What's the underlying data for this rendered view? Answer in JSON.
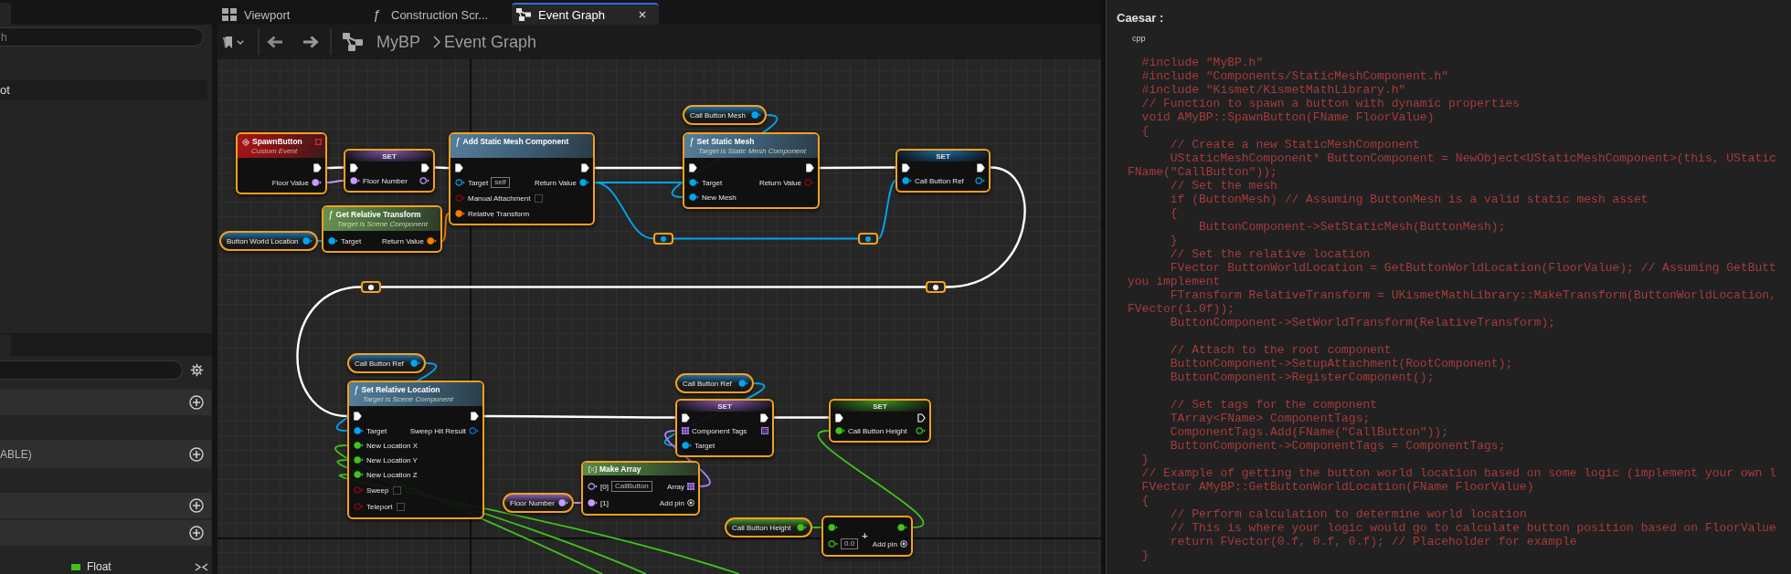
{
  "left_panel": {
    "components": {
      "search": {
        "placeholder": "h"
      },
      "items": [
        {
          "label": "ot"
        }
      ]
    },
    "my_blueprint": {
      "sections": [
        {
          "add_button": true
        },
        {
          "label": "ABLE)",
          "add_button": true
        },
        {
          "add_button": true
        },
        {
          "add_button": true
        }
      ],
      "variables": [
        {
          "type_label": "Float",
          "color": "#3cc21a"
        }
      ]
    }
  },
  "tabs": [
    {
      "label": "Viewport",
      "kind": "viewport",
      "selected": false
    },
    {
      "label": "Construction Scr...",
      "kind": "function",
      "glyph": "ƒ",
      "selected": false
    },
    {
      "label": "Event Graph",
      "kind": "graph",
      "selected": true,
      "closable": true
    }
  ],
  "breadcrumb": [
    "MyBP",
    "Event Graph"
  ],
  "graph": {
    "nodes": [
      {
        "kind": "getter",
        "title": "Call Button Mesh",
        "selected": true,
        "outputs": [
          {
            "kind": "object",
            "connected": true
          }
        ]
      },
      {
        "kind": "event",
        "title": "SpawnButton",
        "subtitle": "Custom Event",
        "selected": true,
        "header_pin": {
          "kind": "delegate",
          "connected": false
        },
        "outputs": [
          {
            "kind": "exec",
            "connected": true
          },
          {
            "label": "Floor Value",
            "kind": "name",
            "connected": true
          }
        ]
      },
      {
        "kind": "setter",
        "title": "SET",
        "selected": true,
        "inputs": [
          {
            "kind": "exec",
            "connected": true
          },
          {
            "label": "Floor Number",
            "kind": "name",
            "connected": true
          }
        ],
        "outputs": [
          {
            "kind": "exec",
            "connected": true
          },
          {
            "kind": "name",
            "connected": false
          }
        ]
      },
      {
        "kind": "function",
        "glyph": "ƒ",
        "title": "Add Static Mesh Component",
        "selected": true,
        "inputs": [
          {
            "kind": "exec",
            "connected": true
          },
          {
            "label": "Target",
            "kind": "object",
            "connected": false,
            "value": "self"
          },
          {
            "label": "Manual Attachment",
            "kind": "bool",
            "connected": false,
            "checked": false
          },
          {
            "label": "Relative Transform",
            "kind": "transform",
            "connected": true
          }
        ],
        "outputs": [
          {
            "kind": "exec",
            "connected": true
          },
          {
            "label": "Return Value",
            "kind": "object",
            "connected": true
          }
        ]
      },
      {
        "kind": "function",
        "glyph": "ƒ",
        "title": "Set Static Mesh",
        "subtitle": "Target is Static Mesh Component",
        "selected": true,
        "inputs": [
          {
            "kind": "exec",
            "connected": true
          },
          {
            "label": "Target",
            "kind": "object",
            "connected": true
          },
          {
            "label": "New Mesh",
            "kind": "object",
            "connected": true
          }
        ],
        "outputs": [
          {
            "kind": "exec",
            "connected": true
          },
          {
            "label": "Return Value",
            "kind": "bool",
            "connected": false
          }
        ]
      },
      {
        "kind": "setter",
        "title": "SET",
        "selected": true,
        "inputs": [
          {
            "kind": "exec",
            "connected": true
          },
          {
            "label": "Call Button Ref",
            "kind": "object",
            "connected": true
          }
        ],
        "outputs": [
          {
            "kind": "exec",
            "connected": true
          },
          {
            "kind": "object",
            "connected": false
          }
        ]
      },
      {
        "kind": "getter",
        "title": "Button World Location",
        "selected": true,
        "outputs": [
          {
            "kind": "object",
            "connected": true
          }
        ]
      },
      {
        "kind": "pure",
        "glyph": "ƒ",
        "title": "Get Relative Transform",
        "subtitle": "Target is Scene Component",
        "selected": true,
        "inputs": [
          {
            "label": "Target",
            "kind": "object",
            "connected": true
          }
        ],
        "outputs": [
          {
            "label": "Return Value",
            "kind": "transform",
            "connected": true
          }
        ]
      },
      {
        "kind": "reroute",
        "selected": true,
        "outputs": [
          {
            "kind": "object",
            "connected": true
          }
        ]
      },
      {
        "kind": "reroute",
        "selected": true,
        "outputs": [
          {
            "kind": "object",
            "connected": true
          }
        ]
      },
      {
        "kind": "reroute",
        "selected": true,
        "outputs": [
          {
            "kind": "exec",
            "connected": true
          }
        ]
      },
      {
        "kind": "reroute",
        "selected": true,
        "outputs": [
          {
            "kind": "exec",
            "connected": true
          }
        ]
      },
      {
        "kind": "getter",
        "title": "Call Button Ref",
        "selected": true,
        "outputs": [
          {
            "kind": "object",
            "connected": true
          }
        ]
      },
      {
        "kind": "function",
        "glyph": "ƒ",
        "title": "Set Relative Location",
        "subtitle": "Target is Scene Component",
        "selected": true,
        "inputs": [
          {
            "kind": "exec",
            "connected": true
          },
          {
            "label": "Target",
            "kind": "object",
            "connected": true
          },
          {
            "label": "New Location X",
            "kind": "float",
            "connected": true
          },
          {
            "label": "New Location Y",
            "kind": "float",
            "connected": true
          },
          {
            "label": "New Location Z",
            "kind": "float",
            "connected": true
          },
          {
            "label": "Sweep",
            "kind": "bool",
            "connected": false,
            "checked": false
          },
          {
            "label": "Teleport",
            "kind": "bool",
            "connected": false,
            "checked": false
          }
        ],
        "outputs": [
          {
            "kind": "exec",
            "connected": true
          },
          {
            "label": "Sweep Hit Result",
            "kind": "struct",
            "connected": false
          }
        ]
      },
      {
        "kind": "getter",
        "title": "Call Button Ref",
        "selected": true,
        "outputs": [
          {
            "kind": "object",
            "connected": true
          }
        ]
      },
      {
        "kind": "setter",
        "title": "SET",
        "selected": true,
        "inputs": [
          {
            "kind": "exec",
            "connected": true
          },
          {
            "label": "Component Tags",
            "kind": "name_array",
            "connected": true
          },
          {
            "label": "Target",
            "kind": "object",
            "connected": true
          }
        ],
        "outputs": [
          {
            "kind": "exec",
            "connected": true
          },
          {
            "kind": "name_array",
            "connected": false
          }
        ]
      },
      {
        "kind": "setter",
        "title": "SET",
        "selected": true,
        "inputs": [
          {
            "kind": "exec",
            "connected": true
          },
          {
            "label": "Call Button Height",
            "kind": "float",
            "connected": true
          }
        ],
        "outputs": [
          {
            "kind": "exec",
            "connected": false
          },
          {
            "kind": "float",
            "connected": false
          }
        ]
      },
      {
        "kind": "getter",
        "title": "Floor Number",
        "selected": true,
        "outputs": [
          {
            "kind": "name",
            "connected": true
          }
        ]
      },
      {
        "kind": "make_array",
        "title": "Make Array",
        "selected": true,
        "inputs": [
          {
            "label": "[0]",
            "kind": "name",
            "connected": false,
            "value": "CallButton"
          },
          {
            "label": "[1]",
            "kind": "name",
            "connected": true
          }
        ],
        "outputs": [
          {
            "label": "Array",
            "kind": "name_array",
            "connected": true
          }
        ],
        "add_pin": "Add pin"
      },
      {
        "kind": "getter",
        "title": "Call Button Height",
        "selected": true,
        "outputs": [
          {
            "kind": "float",
            "connected": true
          }
        ]
      },
      {
        "kind": "math",
        "title": "+",
        "selected": true,
        "inputs": [
          {
            "kind": "float",
            "connected": true
          },
          {
            "kind": "float",
            "connected": false,
            "value": "0.0"
          }
        ],
        "outputs": [
          {
            "kind": "float",
            "connected": true
          }
        ],
        "add_pin": "Add pin"
      }
    ],
    "wires": [
      {
        "kind": "exec"
      },
      {
        "kind": "exec"
      },
      {
        "kind": "exec"
      },
      {
        "kind": "exec"
      },
      {
        "kind": "exec"
      },
      {
        "kind": "exec"
      },
      {
        "kind": "exec"
      },
      {
        "kind": "exec"
      },
      {
        "kind": "exec"
      },
      {
        "kind": "name"
      },
      {
        "kind": "transform"
      },
      {
        "kind": "object"
      },
      {
        "kind": "object"
      },
      {
        "kind": "object"
      },
      {
        "kind": "object"
      },
      {
        "kind": "object"
      },
      {
        "kind": "object"
      },
      {
        "kind": "object"
      },
      {
        "kind": "object"
      },
      {
        "kind": "name"
      },
      {
        "kind": "name_array"
      },
      {
        "kind": "float"
      },
      {
        "kind": "float"
      },
      {
        "kind": "float"
      },
      {
        "kind": "float"
      },
      {
        "kind": "float"
      }
    ]
  },
  "assistant": {
    "author": "Caesar :",
    "language": "cpp",
    "code": "  #include \"MyBP.h\"\n  #include \"Components/StaticMeshComponent.h\"\n  #include \"Kismet/KismetMathLibrary.h\"\n  // Function to spawn a button with dynamic properties\n  void AMyBP::SpawnButton(FName FloorValue)\n  {\n      // Create a new StaticMeshComponent\n      UStaticMeshComponent* ButtonComponent = NewObject<UStaticMeshComponent>(this, UStatic\nFName(\"CallButton\"));\n      // Set the mesh\n      if (ButtonMesh) // Assuming ButtonMesh is a valid static mesh asset\n      {\n          ButtonComponent->SetStaticMesh(ButtonMesh);\n      }\n      // Set the relative location\n      FVector ButtonWorldLocation = GetButtonWorldLocation(FloorValue); // Assuming GetButt\nyou implement\n      FTransform RelativeTransform = UKismetMathLibrary::MakeTransform(ButtonWorldLocation,\nFVector(1.0f));\n      ButtonComponent->SetWorldTransform(RelativeTransform);\n\n      // Attach to the root component\n      ButtonComponent->SetupAttachment(RootComponent);\n      ButtonComponent->RegisterComponent();\n\n      // Set tags for the component\n      TArray<FName> ComponentTags;\n      ComponentTags.Add(FName(\"CallButton\"));\n      ButtonComponent->ComponentTags = ComponentTags;\n  }\n  // Example of getting the button world location based on some logic (implement your own l\n  FVector AMyBP::GetButtonWorldLocation(FName FloorValue)\n  {\n      // Perform calculation to determine world location\n      // This is where your logic would go to calculate button position based on FloorValue\n      return FVector(0.f, 0.f, 0.f); // Placeholder for example\n  }"
  }
}
